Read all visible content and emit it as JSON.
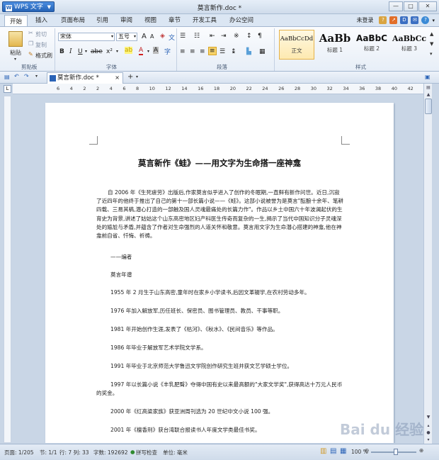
{
  "app": {
    "brand": "WPS 文字",
    "window_title": "莫言新作.doc *"
  },
  "window_controls": {
    "minimize": "—",
    "restore": "□",
    "close": "✕"
  },
  "menu_tabs": [
    "开始",
    "插入",
    "页面布局",
    "引用",
    "审阅",
    "视图",
    "章节",
    "开发工具",
    "办公空间"
  ],
  "account_status": "未登录",
  "ribbon": {
    "clipboard": {
      "paste": "粘贴",
      "cut": "剪切",
      "copy": "复制",
      "format_painter": "格式刷",
      "label": "剪贴板"
    },
    "font": {
      "font_name": "宋体",
      "font_size": "五号",
      "label": "字体",
      "bold": "B",
      "italic": "I",
      "underline": "U",
      "grow": "A",
      "shrink": "A"
    },
    "paragraph": {
      "label": "段落"
    },
    "styles": {
      "label": "样式",
      "items": [
        {
          "sample": "AaBbCcDd",
          "name": "正文"
        },
        {
          "sample": "AaBb",
          "name": "标题 1"
        },
        {
          "sample": "AaBbC",
          "name": "标题 2"
        },
        {
          "sample": "AaBbCc",
          "name": "标题 3"
        }
      ]
    }
  },
  "document_tab": {
    "name": "莫言新作.doc *",
    "close": "×",
    "new": "+"
  },
  "ruler": {
    "corner": "L",
    "numbers": "6  4  2  2  4  6  8  10  12  14  16  18  20  22  24  26  28  30  32  34  36  38  40  42  44  46"
  },
  "document": {
    "title": "莫言新作《蛙》——用文字为生命搭一座神龛",
    "intro": "自 2006 年《生死疲劳》出版后,作家莫言似乎进入了创作的冬眠期,一直鲜有新作问世。近日,沉寂了近四年的他终于推出了自己的第十一部长篇小说——《蛙》。这部小说被誉为是莫言\"酝酿十余年、笔耕四载、三易其稿,潜心打造的一部触及国人灵魂最痛处的长篇力作\"。作品以乡土中国六十年波澜起伏的生育史为背景,讲述了姑姑这个山东高密地区妇产科医生传奇而复杂的一生,揭示了当代中国知识分子灵魂深处的尴尬与矛盾,并蕴含了作者对生命强烈的人道关怀和敬意。莫言用文字为生命潜心搭建的神龛,他在神龛前自省、忏悔、祈祷。",
    "editor_note": "——编者",
    "bio_heading": "莫言年谱",
    "bio": [
      "1955 年 2 月生于山东高密,童年时在家乡小学读书,后因文革辍学,在农村劳动多年。",
      "1976 年加入解放军,历任班长、保密员、图书管理员、教员、干事等职。",
      "1981 年开始创作生涯,发表了《枯河》、《秋水》、《民间音乐》等作品。",
      "1986 年毕业于解放军艺术学院文学系。",
      "1991 年毕业于北京师范大学鲁迅文学院创作研究生班并获文艺学硕士学位。",
      "1997 年以长篇小说《丰乳肥臀》夺得中国有史以来最高额的\"大家文学奖\",获得高达十万元人民币的奖金。",
      "2000 年《红高粱家族》获亚洲周刊选为 20 世纪中文小说 100 强。",
      "2001 年《檀香刑》获台湾联合报读书人年度文学类最佳书奖。"
    ]
  },
  "status_bar": {
    "page": "页面: 1/205",
    "section": "节: 1/1",
    "row_col": "行: 7  列: 33",
    "word_count": "字数: 192692",
    "spell": "拼写检查",
    "unit": "单位: 毫米",
    "zoom": "100 %"
  },
  "watermark": "Bai du 经验",
  "colors": {
    "accent": "#2b63b6",
    "ribbon_bg": "#e7eef7",
    "canvas_bg": "#c9d6e6"
  }
}
